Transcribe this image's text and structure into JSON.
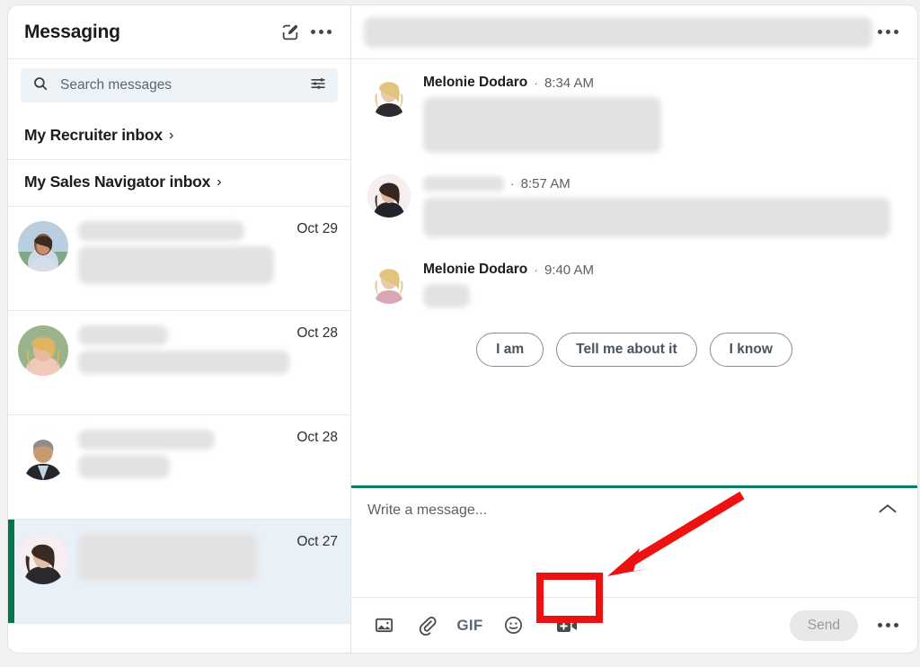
{
  "left_panel": {
    "title": "Messaging",
    "compose_icon": "compose-pencil-icon",
    "overflow_icon": "overflow-menu-icon",
    "search": {
      "placeholder": "Search messages",
      "value": "",
      "search_icon": "search-icon",
      "filter_icon": "filter-sliders-icon"
    },
    "inboxes": [
      {
        "label": "My Recruiter inbox",
        "chevron": "›"
      },
      {
        "label": "My Sales Navigator inbox",
        "chevron": "›"
      }
    ],
    "conversations": [
      {
        "name_redacted": true,
        "preview_redacted": true,
        "date": "Oct 29",
        "selected": false
      },
      {
        "name_redacted": true,
        "preview_redacted": true,
        "date": "Oct 28",
        "selected": false
      },
      {
        "name_redacted": true,
        "preview_redacted": true,
        "date": "Oct 28",
        "selected": false
      },
      {
        "name_redacted": true,
        "preview_redacted": true,
        "date": "Oct 27",
        "selected": true
      }
    ]
  },
  "thread": {
    "header_redacted": true,
    "header_overflow_icon": "overflow-menu-icon",
    "messages": [
      {
        "sender": "Melonie Dodaro",
        "sender_redacted": false,
        "separator": "·",
        "time": "8:34 AM"
      },
      {
        "sender": "",
        "sender_redacted": true,
        "separator": "·",
        "time": "8:57 AM"
      },
      {
        "sender": "Melonie Dodaro",
        "sender_redacted": false,
        "separator": "·",
        "time": "9:40 AM"
      }
    ],
    "quick_replies": [
      "I am",
      "Tell me about it",
      "I know"
    ]
  },
  "compose": {
    "placeholder": "Write a message...",
    "value": "",
    "collapse_icon": "chevron-up-icon",
    "tools": [
      {
        "name": "image-icon",
        "label": ""
      },
      {
        "name": "attachment-paperclip-icon",
        "label": ""
      },
      {
        "name": "gif-icon",
        "label": "GIF"
      },
      {
        "name": "emoji-smiley-icon",
        "label": ""
      },
      {
        "name": "video-add-icon",
        "label": ""
      }
    ],
    "send_label": "Send",
    "send_disabled": true,
    "overflow_icon": "overflow-menu-icon"
  },
  "annotation": {
    "highlight_target": "video-add-icon",
    "highlight_color": "#ee1111",
    "arrow_color": "#ee1111"
  },
  "colors": {
    "accent_green": "#0a8060",
    "selected_bar_green": "#01754f",
    "selected_row_bg": "#eaf0f8",
    "search_bg": "#eef3f8",
    "page_bg": "#f1f1ef"
  }
}
